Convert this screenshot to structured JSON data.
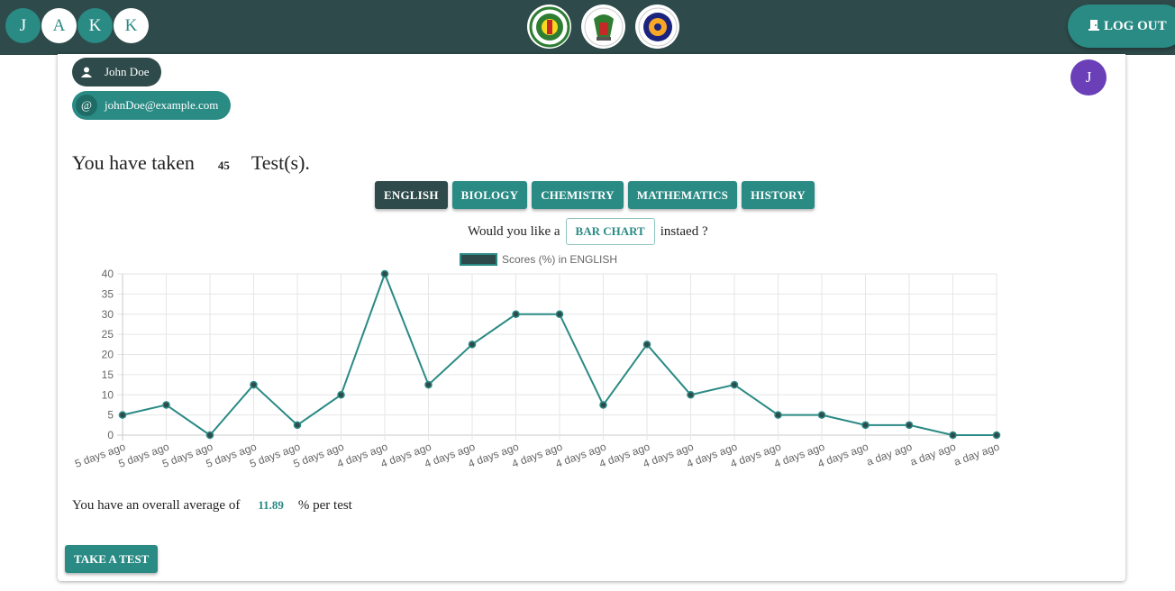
{
  "header": {
    "brand_letters": [
      "J",
      "A",
      "K",
      "K"
    ],
    "logos": [
      "jamb-logo-icon",
      "neco-logo-icon",
      "waec-logo-icon"
    ],
    "logout_label": "LOG OUT",
    "logout_icon": "door-icon"
  },
  "user": {
    "name": "John Doe",
    "email": "johnDoe@example.com",
    "avatar_letter": "J",
    "name_icon": "person-icon",
    "email_icon_glyph": "@"
  },
  "summary": {
    "prefix": "You have taken",
    "count": "45",
    "suffix": "Test(s)."
  },
  "subjects": [
    "ENGLISH",
    "BIOLOGY",
    "CHEMISTRY",
    "MATHEMATICS",
    "HISTORY"
  ],
  "active_subject": "ENGLISH",
  "chart_toggle": {
    "prefix": "Would you like a",
    "button_label": "BAR CHART",
    "suffix": "instaed ?"
  },
  "average": {
    "prefix": "You have an overall average of",
    "value": "11.89",
    "suffix": "% per test"
  },
  "take_test_label": "TAKE A TEST",
  "colors": {
    "header": "#2e4a4a",
    "accent": "#2a8a84",
    "avatar": "#6a3fb8"
  },
  "chart_data": {
    "type": "line",
    "title": "",
    "xlabel": "",
    "ylabel": "",
    "series": [
      {
        "name": "Scores (%) in ENGLISH",
        "values": [
          5,
          7.5,
          0,
          12.5,
          2.5,
          10,
          40,
          12.5,
          22.5,
          30,
          30,
          7.5,
          22.5,
          10,
          12.5,
          5,
          5,
          2.5,
          2.5,
          0,
          0
        ]
      }
    ],
    "categories": [
      "5 days ago",
      "5 days ago",
      "5 days ago",
      "5 days ago",
      "5 days ago",
      "5 days ago",
      "4 days ago",
      "4 days ago",
      "4 days ago",
      "4 days ago",
      "4 days ago",
      "4 days ago",
      "4 days ago",
      "4 days ago",
      "4 days ago",
      "4 days ago",
      "4 days ago",
      "4 days ago",
      "a day ago",
      "a day ago",
      "a day ago"
    ],
    "yticks": [
      0,
      5,
      10,
      15,
      20,
      25,
      30,
      35,
      40
    ],
    "ylim": [
      0,
      40
    ],
    "grid": true,
    "legend": "top-center"
  }
}
